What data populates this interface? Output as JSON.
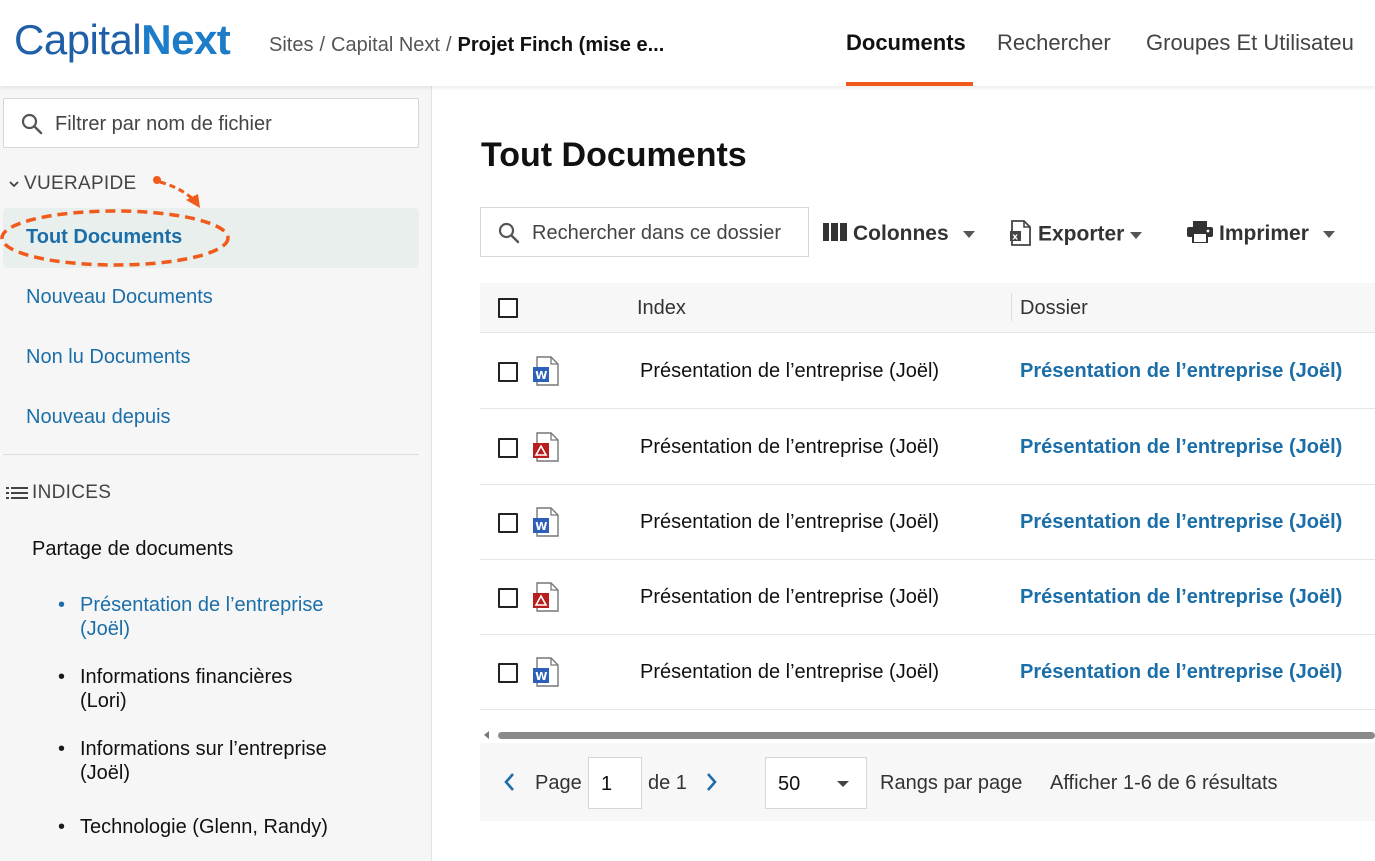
{
  "header": {
    "logo_part1": "Capital",
    "logo_part2": "Next",
    "breadcrumb": [
      "Sites",
      "Capital Next",
      "Projet Finch (mise e..."
    ],
    "nav": [
      "Documents",
      "Rechercher",
      "Groupes Et Utilisateu"
    ],
    "active_nav": "Documents",
    "accent_color": "#f05a1a"
  },
  "sidebar": {
    "filter_placeholder": "Filtrer par nom de fichier",
    "quickview_title": "VUERAPIDE",
    "quickview_items": [
      "Tout Documents",
      "Nouveau Documents",
      "Non lu Documents",
      "Nouveau depuis"
    ],
    "active_item": "Tout Documents",
    "indices_title": "INDICES",
    "tree_root": "Partage de documents",
    "tree_items": [
      {
        "line1": "Présentation de l’entreprise",
        "line2": "(Joël)"
      },
      {
        "line1": "Informations financières",
        "line2": "(Lori)"
      },
      {
        "line1": "Informations sur l’entreprise",
        "line2": "(Joël)"
      },
      {
        "line1": "Technologie (Glenn, Randy)",
        "line2": ""
      }
    ]
  },
  "main": {
    "title": "Tout Documents",
    "search_placeholder": "Rechercher dans ce dossier",
    "toolbar": {
      "columns": "Colonnes",
      "export": "Exporter",
      "print": "Imprimer"
    },
    "table": {
      "headers": [
        "Index",
        "Dossier"
      ],
      "rows": [
        {
          "icon": "word-file-icon",
          "name": "Présentation de l’entreprise (Joël)",
          "dossier": "Présentation de l’entreprise (Joël)"
        },
        {
          "icon": "pdf-file-icon",
          "name": "Présentation de l’entreprise (Joël)",
          "dossier": "Présentation de l’entreprise (Joël)"
        },
        {
          "icon": "word-file-icon",
          "name": "Présentation de l’entreprise (Joël)",
          "dossier": "Présentation de l’entreprise (Joël)"
        },
        {
          "icon": "pdf-file-icon",
          "name": "Présentation de l’entreprise (Joël)",
          "dossier": "Présentation de l’entreprise (Joël)"
        },
        {
          "icon": "word-file-icon",
          "name": "Présentation de l’entreprise (Joël)",
          "dossier": "Présentation de l’entreprise (Joël)"
        }
      ]
    },
    "pager": {
      "page_label": "Page",
      "page_value": "1",
      "of_label": "de 1",
      "per_page_value": "50",
      "per_page_label": "Rangs par page",
      "results": "Afficher 1-6 de 6 résultats"
    }
  }
}
